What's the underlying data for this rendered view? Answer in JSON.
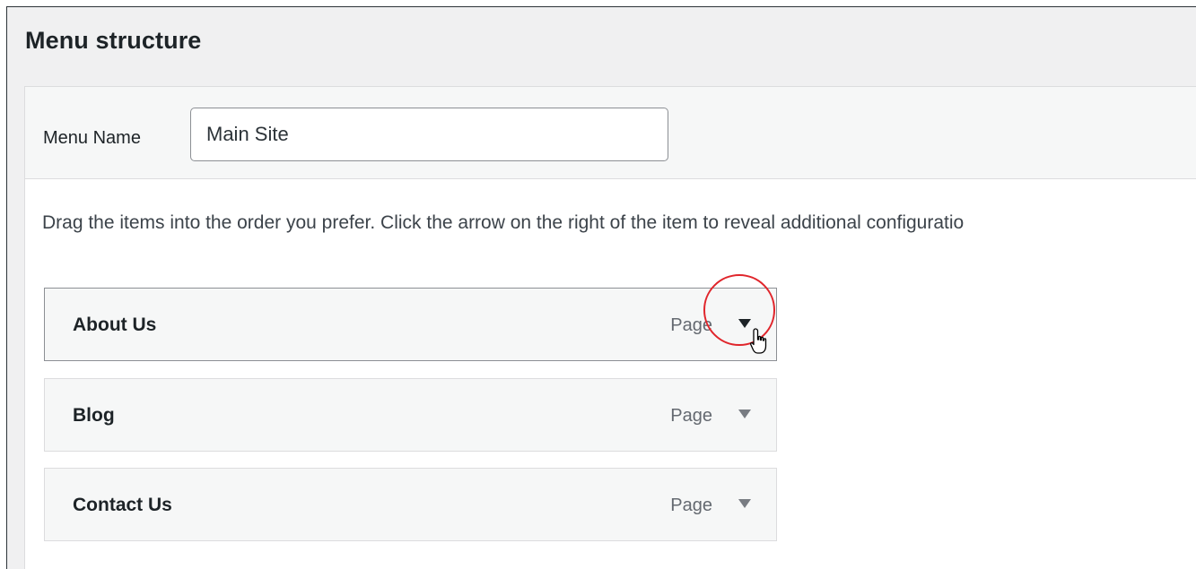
{
  "page": {
    "title": "Menu structure"
  },
  "menu_name": {
    "label": "Menu Name",
    "value": "Main Site"
  },
  "instructions": "Drag the items into the order you prefer. Click the arrow on the right of the item to reveal additional configuratio",
  "menu_items": [
    {
      "title": "About Us",
      "type": "Page",
      "state": "hovered"
    },
    {
      "title": "Blog",
      "type": "Page"
    },
    {
      "title": "Contact Us",
      "type": "Page"
    }
  ],
  "icons": {
    "toggle": "triangle-down-icon",
    "cursor": "hand-pointer-icon"
  },
  "colors": {
    "highlight": "#e0252b",
    "background": "#f0f0f1",
    "item_background": "#f6f7f7"
  }
}
